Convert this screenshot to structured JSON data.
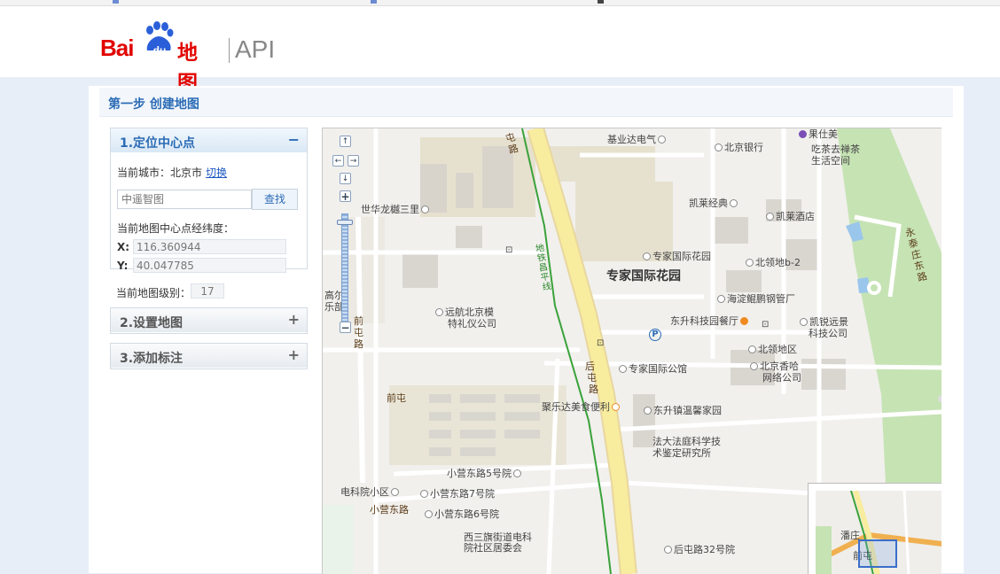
{
  "header": {
    "logo_bai": "Bai",
    "logo_du": "du",
    "logo_ditu": "地图",
    "logo_api": "API"
  },
  "step_title": "第一步 创建地图",
  "panel1": {
    "title": "1.定位中心点",
    "toggle": "−",
    "city_label": "当前城市：北京市",
    "switch_link": "切换",
    "search_placeholder": "中遥智图",
    "search_button": "查找",
    "center_label": "当前地图中心点经纬度：",
    "x_label": "X:",
    "x_value": "116.360944",
    "y_label": "Y:",
    "y_value": "40.047785",
    "zoom_label": "当前地图级别：",
    "zoom_value": "17"
  },
  "panel2": {
    "title": "2.设置地图",
    "toggle": "+"
  },
  "panel3": {
    "title": "3.添加标注",
    "toggle": "+"
  },
  "map": {
    "labels": {
      "jiye": "基业达电气",
      "bank": "北京银行",
      "guoshimei": "果仕美",
      "chicha": "吃茶去禅茶",
      "chicha2": "生活空间",
      "shihua": "世华龙樾三里",
      "kailai": "凯莱经典",
      "kailai_hotel": "凯莱酒店",
      "yongtai": "永泰庄东路",
      "zhuanjia_garden": "专家国际花园",
      "zhuanjia_big": "专家国际花园",
      "beiling_b2": "北领地b-2",
      "haidian": "海淀鲲鹏钢管厂",
      "dongsheng": "东升科技园餐厅",
      "kairui": "凯锐远景",
      "kairui2": "科技公司",
      "yuanhang": "远航北京模",
      "yuanhang2": "特礼仪公司",
      "gaoer": "高尔",
      "gaoer2": "乐部",
      "qiantun_v1": "前",
      "qiantun_v2": "屯",
      "qiantun_v3": "路",
      "beiling": "北领地区",
      "zhuanjia_apt": "专家国际公馆",
      "xiangha": "北京香哈",
      "xiangha2": "网络公司",
      "qiantun": "前屯",
      "julei": "聚乐达美食便利",
      "dongsheng_home": "东升镇温馨家园",
      "fada": "法大法庭科学技",
      "fada2": "术鉴定研究所",
      "xiaoying5": "小营东路5号院",
      "dianke": "电科院小区",
      "xiaoying7": "小营东路7号院",
      "xiaoying_rd": "小营东路",
      "xiaoying6": "小营东路6号院",
      "xisanqi": "西三旗街道电科",
      "xisanqi2": "院社区居委会",
      "houtun32": "后屯路32号院",
      "houtun_road_a": "后",
      "houtun_road_b": "屯",
      "houtun_road_c": "路",
      "ditie": "地铁昌平线",
      "top_road": "屯路",
      "qianzhong": "前屯",
      "ov_panzhuang": "潘庄",
      "ov_qiantun": "前屯"
    },
    "nav": {
      "up": "↑",
      "left": "←",
      "right": "→",
      "down": "↓",
      "zoom_in": "+",
      "zoom_out": "−"
    }
  },
  "colors": {
    "accent": "#2b6bb5",
    "brand_red": "#e10601",
    "road_yellow": "#f6e9a1",
    "metro_green": "#3aa23a",
    "park_green": "#c6e3b4"
  }
}
